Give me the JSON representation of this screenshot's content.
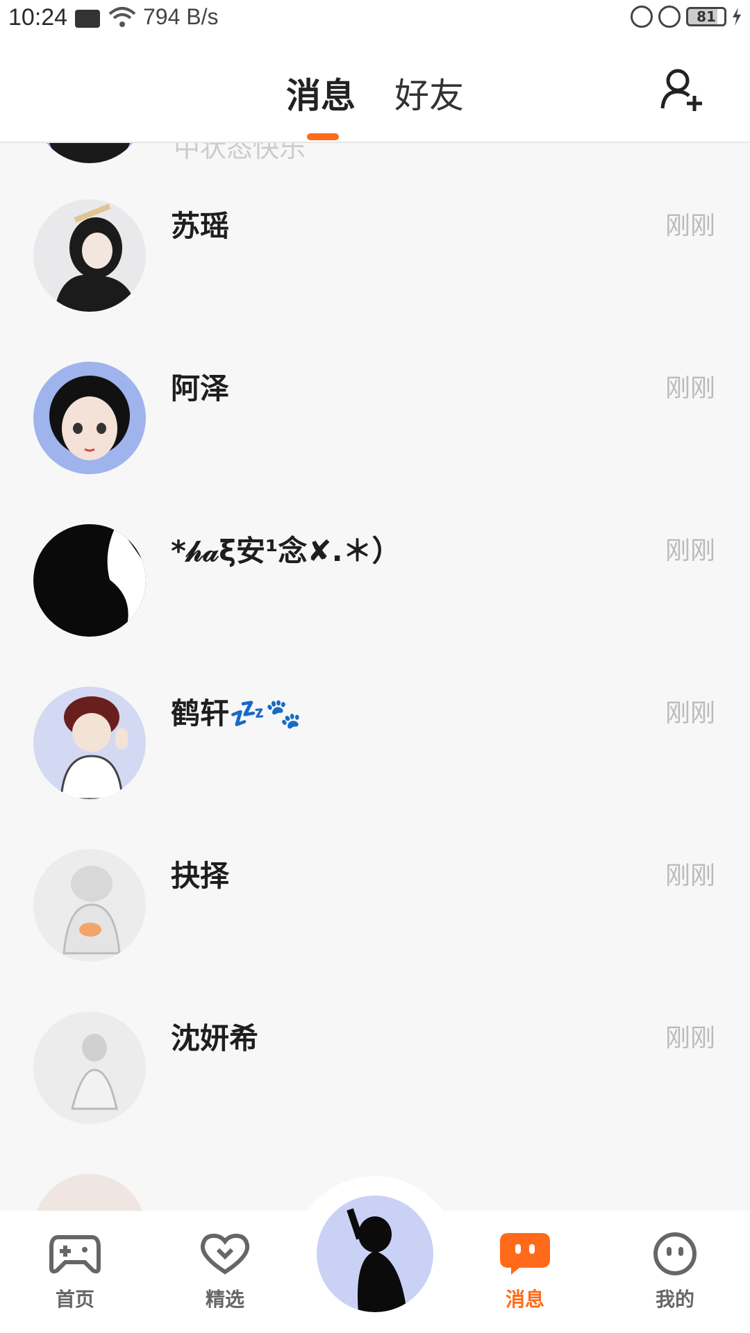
{
  "status_bar": {
    "time": "10:24",
    "net_speed": "794 B/s",
    "battery": "81"
  },
  "header": {
    "tab_messages": "消息",
    "tab_friends": "好友"
  },
  "partial_top": {
    "snippet": "中状态快乐"
  },
  "conversations": [
    {
      "name": "苏瑶",
      "time": "刚刚",
      "avatar_bg": "#e9e9ec",
      "avatar_fg": "#1b1b1b"
    },
    {
      "name": "阿泽",
      "time": "刚刚",
      "avatar_bg": "#9fb3ec",
      "avatar_fg": "#111111"
    },
    {
      "name": "*𝒽𝒶ξ安¹念✘.＊）",
      "time": "刚刚",
      "avatar_bg": "#0a0a0a",
      "avatar_fg": "#ffffff"
    },
    {
      "name": "鹤轩💤🐾",
      "time": "刚刚",
      "avatar_bg": "#d3d9f2",
      "avatar_fg": "#6a1f1f"
    },
    {
      "name": "抉择",
      "time": "刚刚",
      "avatar_bg": "#ececec",
      "avatar_fg": "#bdbdbd"
    },
    {
      "name": "沈妍希",
      "time": "刚刚",
      "avatar_bg": "#ececec",
      "avatar_fg": "#c8c8c8"
    }
  ],
  "bottom_nav": {
    "home": "首页",
    "featured": "精选",
    "messages": "消息",
    "profile": "我的"
  },
  "colors": {
    "accent": "#ff6a1a",
    "inactive_icon": "#666666"
  }
}
